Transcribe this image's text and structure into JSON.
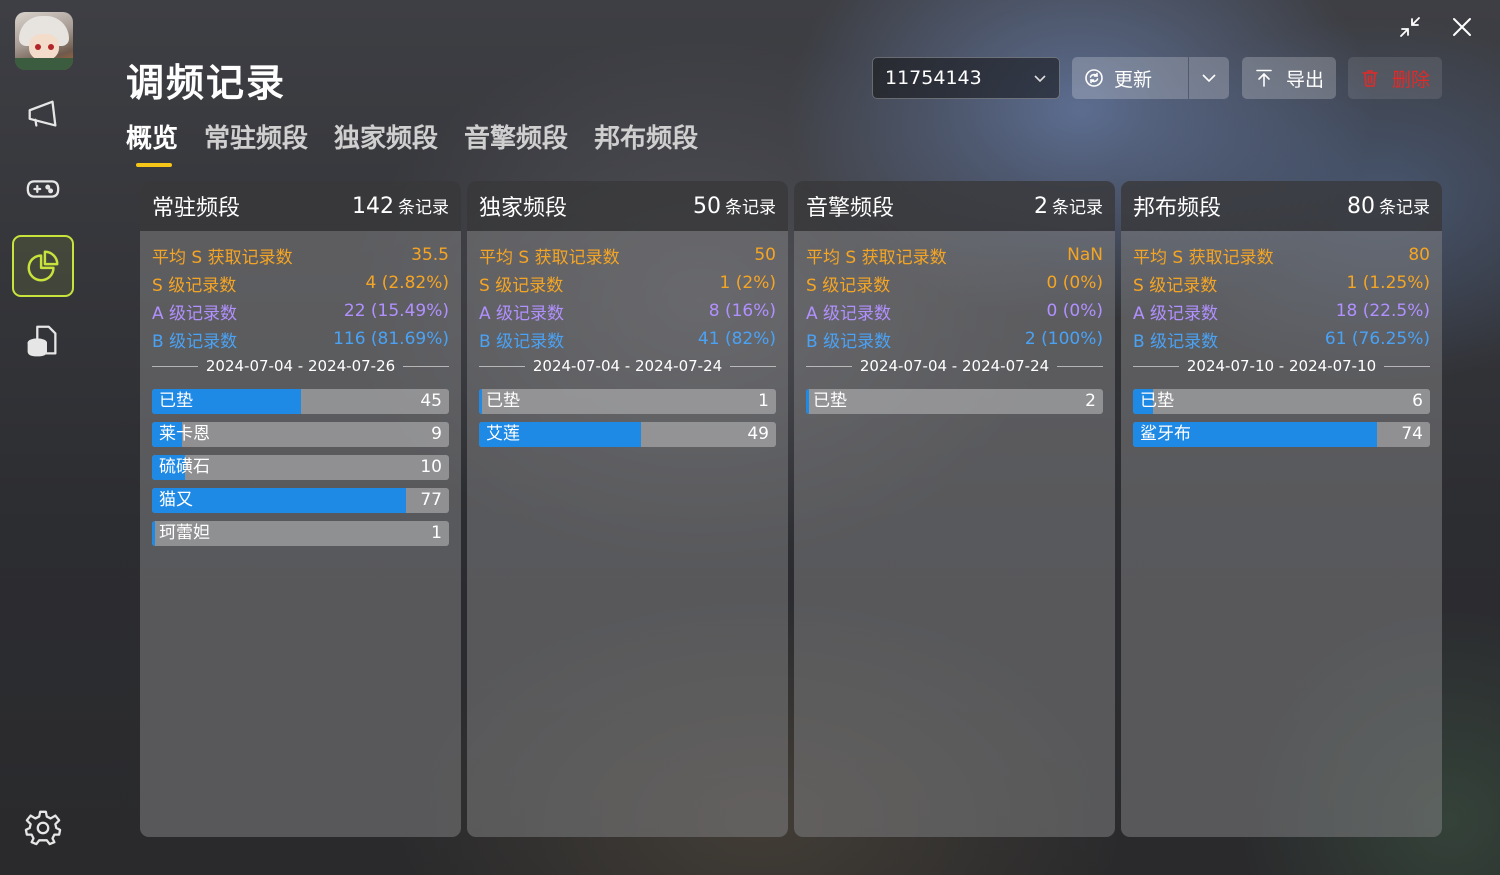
{
  "title": "调频记录",
  "tabs": [
    {
      "label": "概览",
      "active": true
    },
    {
      "label": "常驻频段",
      "active": false
    },
    {
      "label": "独家频段",
      "active": false
    },
    {
      "label": "音擎频段",
      "active": false
    },
    {
      "label": "邦布频段",
      "active": false
    }
  ],
  "toolbar": {
    "uid": "11754143",
    "refresh_label": "更新",
    "export_label": "导出",
    "delete_label": "删除"
  },
  "sidebar": {
    "icons": [
      "announcement-icon",
      "gamepad-icon",
      "pie-chart-icon",
      "database-export-icon"
    ],
    "settings_icon": "gear-icon"
  },
  "colors": {
    "accent_active": "#c8e33c",
    "tab_underline": "#f5c518",
    "s_rank": "#f5a524",
    "a_rank": "#b190ff",
    "b_rank": "#4aa2f5",
    "bar_fill": "#1f8ae6",
    "delete": "#e02a2a"
  },
  "unit_label": "条记录",
  "labels": {
    "avg": "平均 S 获取记录数",
    "s": "S 级记录数",
    "a": "A 级记录数",
    "b": "B 级记录数"
  },
  "cards": [
    {
      "title": "常驻频段",
      "count": "142",
      "avg": "35.5",
      "s": "4 (2.82%)",
      "a": "22 (15.49%)",
      "b": "116 (81.69%)",
      "date_range": "2024-07-04 - 2024-07-26",
      "bar_scale": 90,
      "bars": [
        {
          "name": "已垫",
          "value": 45
        },
        {
          "name": "莱卡恩",
          "value": 9
        },
        {
          "name": "硫磺石",
          "value": 10
        },
        {
          "name": "猫又",
          "value": 77
        },
        {
          "name": "珂蕾妲",
          "value": 1
        }
      ]
    },
    {
      "title": "独家频段",
      "count": "50",
      "avg": "50",
      "s": "1 (2%)",
      "a": "8 (16%)",
      "b": "41 (82%)",
      "date_range": "2024-07-04 - 2024-07-24",
      "bar_scale": 90,
      "bars": [
        {
          "name": "已垫",
          "value": 1
        },
        {
          "name": "艾莲",
          "value": 49
        }
      ]
    },
    {
      "title": "音擎频段",
      "count": "2",
      "avg": "NaN",
      "s": "0 (0%)",
      "a": "0 (0%)",
      "b": "2 (100%)",
      "date_range": "2024-07-04 - 2024-07-24",
      "bar_scale": 80,
      "bars": [
        {
          "name": "已垫",
          "value": 2
        }
      ]
    },
    {
      "title": "邦布频段",
      "count": "80",
      "avg": "80",
      "s": "1 (1.25%)",
      "a": "18 (22.5%)",
      "b": "61 (76.25%)",
      "date_range": "2024-07-10 - 2024-07-10",
      "bar_scale": 90,
      "bars": [
        {
          "name": "已垫",
          "value": 6
        },
        {
          "name": "鲨牙布",
          "value": 74
        }
      ]
    }
  ]
}
